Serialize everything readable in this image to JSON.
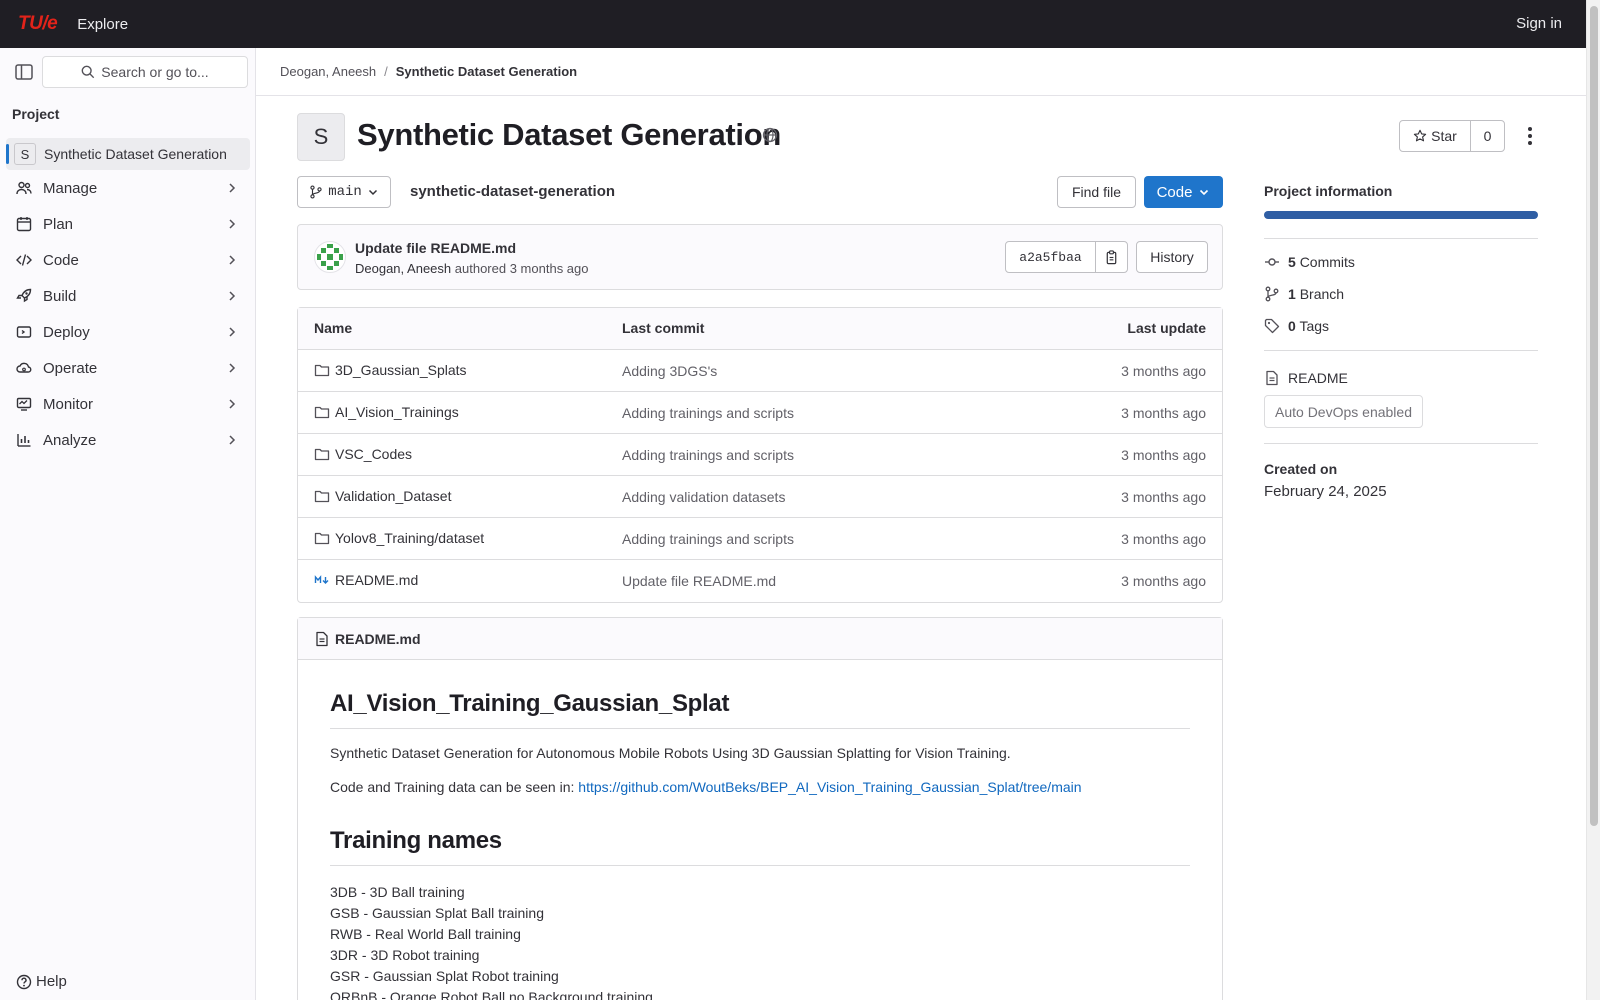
{
  "topbar": {
    "logo": "TU/e",
    "explore": "Explore",
    "sign_in": "Sign in"
  },
  "sidebar": {
    "search_placeholder": "Search or go to...",
    "section_title": "Project",
    "project": {
      "initial": "S",
      "name": "Synthetic Dataset Generation"
    },
    "items": [
      {
        "label": "Manage",
        "icon": "users-icon"
      },
      {
        "label": "Plan",
        "icon": "calendar-icon"
      },
      {
        "label": "Code",
        "icon": "code-icon"
      },
      {
        "label": "Build",
        "icon": "rocket-icon"
      },
      {
        "label": "Deploy",
        "icon": "deployments-icon"
      },
      {
        "label": "Operate",
        "icon": "cloud-gear-icon"
      },
      {
        "label": "Monitor",
        "icon": "monitor-icon"
      },
      {
        "label": "Analyze",
        "icon": "chart-icon"
      }
    ],
    "help": "Help"
  },
  "breadcrumb": {
    "owner": "Deogan, Aneesh",
    "project": "Synthetic Dataset Generation"
  },
  "project": {
    "initial": "S",
    "title": "Synthetic Dataset Generation",
    "star_label": "Star",
    "star_count": "0",
    "branch": "main",
    "path": "synthetic-dataset-generation",
    "find_file": "Find file",
    "code_button": "Code"
  },
  "last_commit": {
    "title": "Update file README.md",
    "author": "Deogan, Aneesh",
    "action": "authored",
    "time": "3 months ago",
    "sha": "a2a5fbaa",
    "history": "History"
  },
  "file_table": {
    "headers": {
      "name": "Name",
      "last_commit": "Last commit",
      "last_update": "Last update"
    },
    "rows": [
      {
        "name": "3D_Gaussian_Splats",
        "type": "folder",
        "commit": "Adding 3DGS's",
        "updated": "3 months ago"
      },
      {
        "name": "AI_Vision_Trainings",
        "type": "folder",
        "commit": "Adding trainings and scripts",
        "updated": "3 months ago"
      },
      {
        "name": "VSC_Codes",
        "type": "folder",
        "commit": "Adding trainings and scripts",
        "updated": "3 months ago"
      },
      {
        "name": "Validation_Dataset",
        "type": "folder",
        "commit": "Adding validation datasets",
        "updated": "3 months ago"
      },
      {
        "name": "Yolov8_Training/dataset",
        "type": "folder",
        "commit": "Adding trainings and scripts",
        "updated": "3 months ago"
      },
      {
        "name": "README.md",
        "type": "markdown",
        "commit": "Update file README.md",
        "updated": "3 months ago"
      }
    ]
  },
  "readme": {
    "filename": "README.md",
    "h1": "AI_Vision_Training_Gaussian_Splat",
    "p1": "Synthetic Dataset Generation for Autonomous Mobile Robots Using 3D Gaussian Splatting for Vision Training.",
    "p2_prefix": "Code and Training data can be seen in: ",
    "p2_link": "https://github.com/WoutBeks/BEP_AI_Vision_Training_Gaussian_Splat/tree/main",
    "h2": "Training names",
    "lines": [
      "3DB - 3D Ball training",
      "GSB - Gaussian Splat Ball training",
      "RWB - Real World Ball training",
      "3DR - 3D Robot training",
      "GSR - Gaussian Splat Robot training",
      "ORBnB - Orange Robot Ball no Background training"
    ]
  },
  "info": {
    "title": "Project information",
    "commits_count": "5",
    "commits_label": "Commits",
    "branches_count": "1",
    "branches_label": "Branch",
    "tags_count": "0",
    "tags_label": "Tags",
    "readme": "README",
    "auto_devops": "Auto DevOps enabled",
    "created_label": "Created on",
    "created_value": "February 24, 2025"
  },
  "colors": {
    "topbar": "#1f1e24",
    "brand": "#e2231a",
    "primary": "#1f75cb",
    "link": "#1068bf",
    "info_bar": "#2f5ea4"
  }
}
